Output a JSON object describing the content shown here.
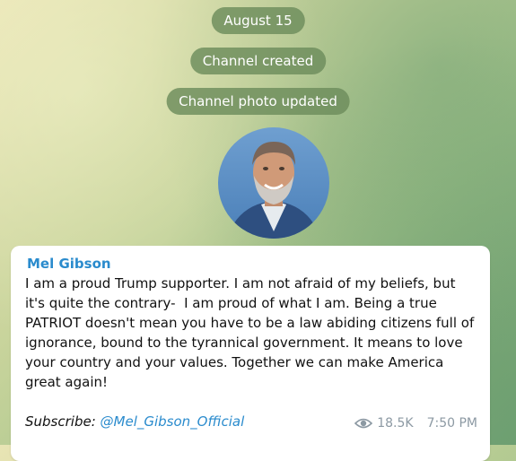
{
  "service_messages": {
    "date": "August 15",
    "created": "Channel created",
    "photo_updated": "Channel photo updated"
  },
  "post": {
    "author": "Mel Gibson",
    "text": "I am a proud Trump supporter. I am not afraid of my beliefs, but it's quite the contrary-  I am proud of what I am. Being a true PATRIOT doesn't mean you have to be a law abiding citizens full of ignorance, bound to the tyrannical government. It means to love your country and your values. Together we can make America great again!",
    "subscribe_label": "Subscribe:",
    "subscribe_link": "@Mel_Gibson_Official",
    "views": "18.5K",
    "time": "7:50 PM"
  },
  "icons": {
    "views": "eye-icon"
  },
  "colors": {
    "link": "#2a8bcd",
    "pill_bg": "#6c8c5c",
    "meta": "#8c99a3"
  }
}
